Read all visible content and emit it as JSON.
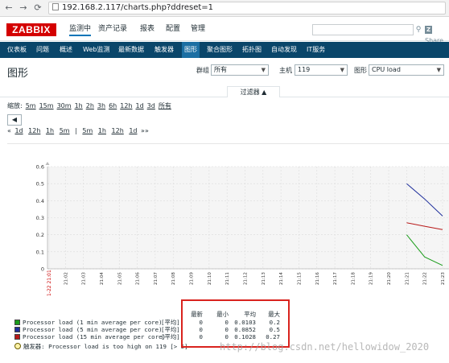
{
  "browser": {
    "url": "192.168.2.117/charts.php?ddreset=1",
    "back_icon": "arrow-left-icon",
    "forward_icon": "arrow-right-icon",
    "reload_icon": "reload-icon"
  },
  "header": {
    "logo": "ZABBIX",
    "menu": [
      "监测中",
      "资产记录",
      "报表",
      "配置",
      "管理"
    ],
    "active_menu": "监测中",
    "share_label": "Share",
    "search_icon": "search-icon",
    "colors": {
      "logo_bg": "#d40000",
      "nav_bg": "#0a466a",
      "nav_active": "#1c6fa3"
    }
  },
  "subnav": {
    "items": [
      "仪表板",
      "问题",
      "概述",
      "Web监测",
      "最新数据",
      "触发器",
      "图形",
      "聚合图形",
      "拓扑图",
      "自动发现",
      "IT服务"
    ],
    "active": "图形"
  },
  "page": {
    "title": "图形",
    "group_label": "群组",
    "group_value": "所有",
    "host_label": "主机",
    "host_value": "119",
    "graph_label": "图形",
    "graph_value": "CPU load"
  },
  "filter": {
    "tab_label": "过滤器 ▲",
    "zoom_label": "缩放:",
    "zoom_options": [
      "5m",
      "15m",
      "30m",
      "1h",
      "2h",
      "3h",
      "6h",
      "12h",
      "1d",
      "3d",
      "所有"
    ],
    "back_label": "◀",
    "scroll_left": "«",
    "scroll_back": [
      "1d",
      "12h",
      "1h",
      "5m"
    ],
    "scroll_fwd": [
      "5m",
      "1h",
      "12h",
      "1d"
    ],
    "scroll_right": "»»",
    "separator": "|"
  },
  "chart_data": {
    "type": "line",
    "y_ticks": [
      "0.6",
      "0.5",
      "0.4",
      "0.3",
      "0.2",
      "0.1",
      "0"
    ],
    "ylim": [
      0,
      0.6
    ],
    "x_ticks": [
      "21:02",
      "21:03",
      "21:04",
      "21:05",
      "21:06",
      "21:07",
      "21:08",
      "21:09",
      "21:10",
      "21:11",
      "21:12",
      "21:13",
      "21:14",
      "21:15",
      "21:16",
      "21:17",
      "21:18",
      "21:19",
      "21:20",
      "21:21",
      "21:22",
      "21:23"
    ],
    "x_start_label": "1-22 21:01",
    "grid": true,
    "series": [
      {
        "name": "Processor load (1 min average per core)",
        "color": "#1a9c1a",
        "values": [
          [
            21.21,
            0.2
          ],
          [
            21.22,
            0.07
          ],
          [
            21.23,
            0.02
          ]
        ]
      },
      {
        "name": "Processor load (5 min average per core)",
        "color": "#1f2f9c",
        "values": [
          [
            21.21,
            0.5
          ],
          [
            21.22,
            0.41
          ],
          [
            21.23,
            0.31
          ]
        ]
      },
      {
        "name": "Processor load (15 min average per core)",
        "color": "#b81818",
        "values": [
          [
            21.21,
            0.27
          ],
          [
            21.22,
            0.25
          ],
          [
            21.23,
            0.23
          ]
        ]
      }
    ]
  },
  "legend": {
    "rows": [
      {
        "label": "Processor load (1 min average per core)",
        "agg": "[平均]",
        "color": "#1a9c1a",
        "last": "0",
        "min": "0",
        "avg": "0.0103",
        "max": "0.2"
      },
      {
        "label": "Processor load (5 min average per core)",
        "agg": "[平均]",
        "color": "#1f2f9c",
        "last": "0",
        "min": "0",
        "avg": "0.0852",
        "max": "0.5"
      },
      {
        "label": "Processor load (15 min average per core)",
        "agg": "[平均]",
        "color": "#b81818",
        "last": "0",
        "min": "0",
        "avg": "0.1028",
        "max": "0.27"
      }
    ],
    "headers": [
      "最新",
      "最小",
      "平均",
      "最大"
    ],
    "trigger": "触发器: Processor load is too high on 119",
    "trigger_suffix": "[> 5]",
    "watermark": "http://blog.csdn.net/hellowidow_2020"
  }
}
